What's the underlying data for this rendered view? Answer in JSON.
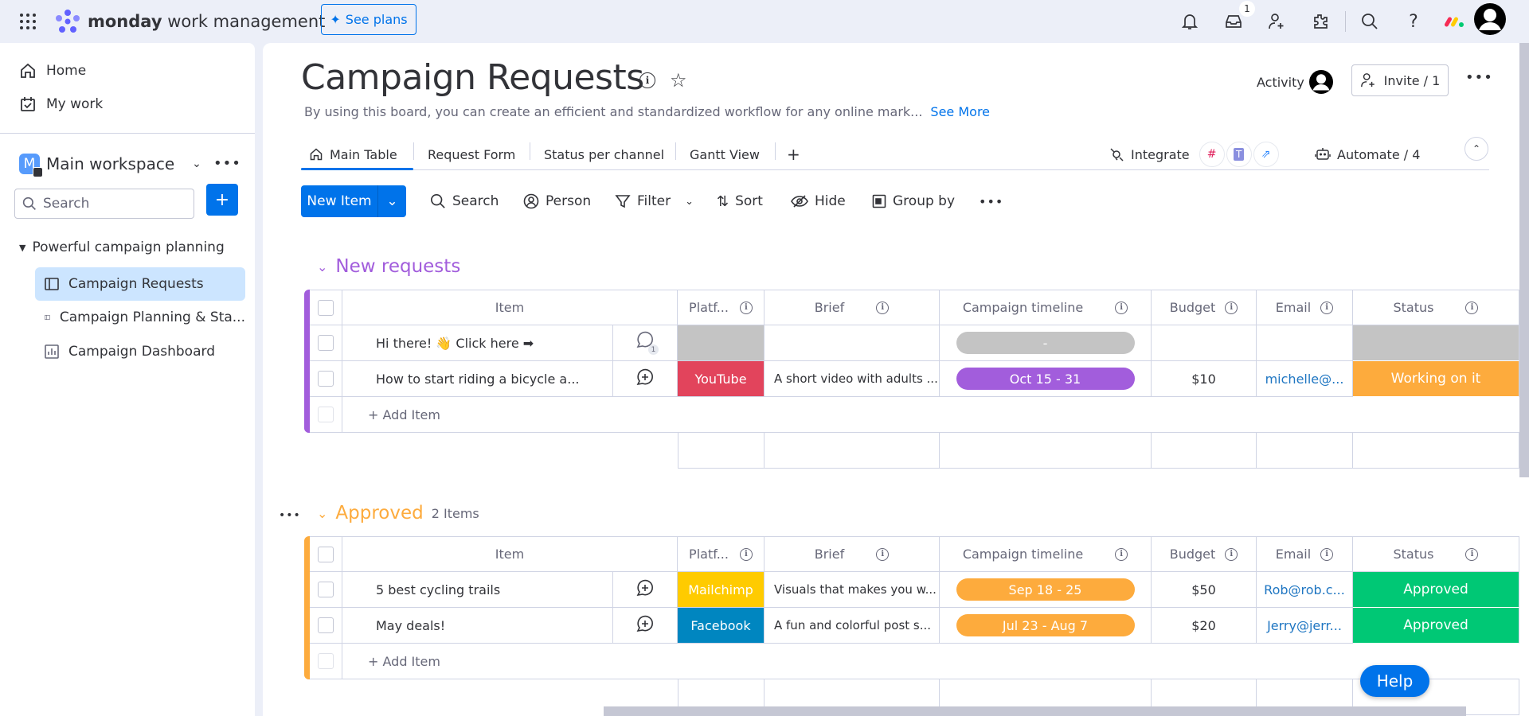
{
  "topbar": {
    "brand_bold": "monday",
    "brand_rest": " work management",
    "see_plans": "See plans",
    "inbox_badge": "1"
  },
  "sidebar": {
    "home": "Home",
    "my_work": "My work",
    "workspace_initial": "M",
    "workspace_name": "Main workspace",
    "search_placeholder": "Search",
    "folder": "Powerful campaign planning",
    "boards": [
      {
        "label": "Campaign Requests",
        "active": true
      },
      {
        "label": "Campaign Planning & Sta...",
        "active": false
      },
      {
        "label": "Campaign Dashboard",
        "active": false
      }
    ]
  },
  "board": {
    "title": "Campaign Requests",
    "description": "By using this board, you can create an efficient and standardized workflow for any online mark...",
    "see_more": "See More",
    "activity": "Activity",
    "invite": "Invite / 1",
    "tabs": [
      "Main Table",
      "Request Form",
      "Status per channel",
      "Gantt View"
    ],
    "add_tab": "+",
    "integrate": "Integrate",
    "automate": "Automate / 4"
  },
  "toolbar": {
    "new_item": "New Item",
    "search": "Search",
    "person": "Person",
    "filter": "Filter",
    "sort": "Sort",
    "hide": "Hide",
    "group_by": "Group by"
  },
  "columns": {
    "item": "Item",
    "platform": "Platf...",
    "brief": "Brief",
    "timeline": "Campaign timeline",
    "budget": "Budget",
    "email": "Email",
    "status": "Status"
  },
  "groups": [
    {
      "title": "New requests",
      "color": "#a25ddc",
      "count": "",
      "add_item": "+ Add Item",
      "rows": [
        {
          "item": "Hi there! 👋 Click here ➡",
          "comments": "1",
          "platform": "",
          "platform_color": "#c4c4c4",
          "brief": "",
          "timeline": "-",
          "timeline_color": "#c4c4c4",
          "budget": "",
          "email": "",
          "status": "",
          "status_color": "#c4c4c4"
        },
        {
          "item": "How to start riding a bicycle a...",
          "comments": "",
          "platform": "YouTube",
          "platform_color": "#e2445c",
          "brief": "A short video with adults ...",
          "timeline": "Oct 15 - 31",
          "timeline_color": "#a25ddc",
          "budget": "$10",
          "email": "michelle@...",
          "status": "Working on it",
          "status_color": "#fdab3d"
        }
      ]
    },
    {
      "title": "Approved",
      "color": "#fdab3d",
      "count": "2 Items",
      "add_item": "+ Add Item",
      "rows": [
        {
          "item": "5 best cycling trails",
          "comments": "",
          "platform": "Mailchimp",
          "platform_color": "#ffcb00",
          "brief": "Visuals that makes you w...",
          "timeline": "Sep 18 - 25",
          "timeline_color": "#fdab3d",
          "budget": "$50",
          "email": "Rob@rob.c...",
          "status": "Approved",
          "status_color": "#00c875"
        },
        {
          "item": "May deals!",
          "comments": "",
          "platform": "Facebook",
          "platform_color": "#0086c0",
          "brief": "A fun and colorful post s...",
          "timeline": "Jul 23 - Aug 7",
          "timeline_color": "#fdab3d",
          "budget": "$20",
          "email": "Jerry@jerr...",
          "status": "Approved",
          "status_color": "#00c875"
        }
      ]
    }
  ],
  "help": "Help"
}
